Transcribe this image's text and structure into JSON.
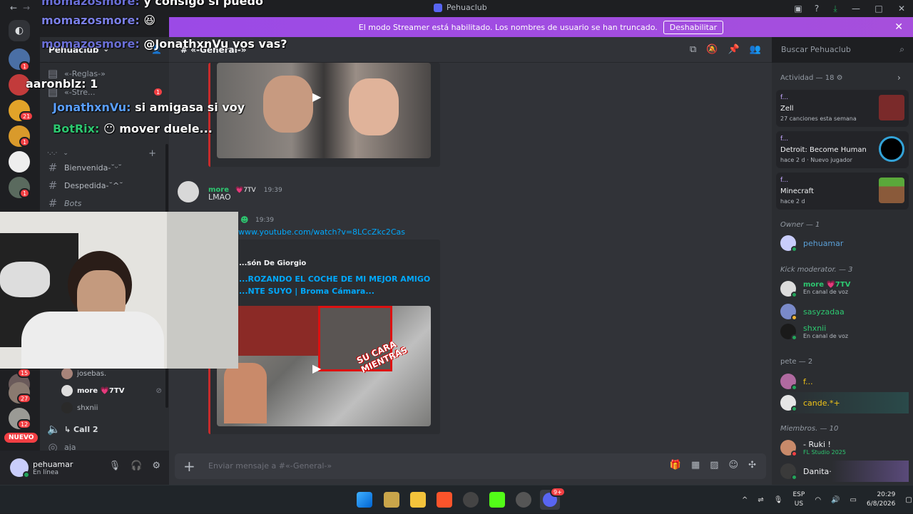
{
  "window": {
    "title": "Pehuaclub",
    "controls": [
      "inbox-icon",
      "help-icon",
      "download-icon",
      "minimize-icon",
      "maximize-icon",
      "close-icon"
    ]
  },
  "banner": {
    "text": "El modo Streamer está habilitado. Los nombres de usuario se han truncado.",
    "button": "Deshabilitar"
  },
  "server": {
    "name": "Pehuaclub",
    "channels_top": [
      "«-Reglas-»",
      "«-Stre..."
    ],
    "category": "·.·.·",
    "channels": [
      {
        "name": "Bienvenida-˘ᵕ˘",
        "type": "text"
      },
      {
        "name": "Despedida-˘^˘",
        "type": "text"
      },
      {
        "name": "Bots",
        "type": "text"
      }
    ],
    "voice_users": [
      "josebas.",
      "more 💗7TV",
      "shxnii"
    ],
    "voice_channels": [
      "↳ Call 2",
      "aja"
    ],
    "new_label": "NUEVO"
  },
  "rail_badges": [
    "1",
    "21",
    "1",
    "1",
    "15",
    "27",
    "12"
  ],
  "user_panel": {
    "username": "pehuamar",
    "status": "En línea"
  },
  "chat": {
    "channel": "«-General-»",
    "messages": [
      {
        "author": "more",
        "tag": "💗7TV",
        "time": "19:39",
        "text": "LMAO"
      },
      {
        "author": "",
        "tag": "",
        "time": "19:39",
        "text": "www.youtube.com/watch?v=8LCcZkc2Cas"
      }
    ],
    "embed": {
      "channel_author": "...són De Giorgio",
      "title_line1": "...ROZANDO EL COCHE DE MI MEJOR AMIGO",
      "title_line2": "...NTE SUYO | Broma Cámara...",
      "thumb_caption": "SU CARA MIENTRAS"
    },
    "composer_placeholder": "Enviar mensaje a #«-General-»"
  },
  "search": {
    "placeholder": "Buscar Pehuaclub"
  },
  "members": {
    "activity_header": "Actividad — 18",
    "activities": [
      {
        "who": "f...",
        "game": "Zell",
        "sub": "27 canciones esta semana"
      },
      {
        "who": "f...",
        "game": "Detroit: Become Human",
        "sub": "hace 2 d",
        "extra": "Nuevo jugador"
      },
      {
        "who": "f...",
        "game": "Minecraft",
        "sub": "hace 2 d"
      }
    ],
    "sections": [
      {
        "title": "Owner — 1",
        "members": [
          {
            "name": "pehuamar",
            "color": "#5a9fd6",
            "status": ""
          }
        ]
      },
      {
        "title": "Kick moderator. — 3",
        "members": [
          {
            "name": "more 💗7TV",
            "color": "#2dc770",
            "status": "En canal de voz"
          },
          {
            "name": "sasyzadaa",
            "color": "#2dc770",
            "status": ""
          },
          {
            "name": "shxnii",
            "color": "#2dc770",
            "status": "En canal de voz"
          }
        ]
      },
      {
        "title": "pete — 2",
        "members": [
          {
            "name": "f...",
            "color": "#f0c419",
            "status": ""
          },
          {
            "name": "cande.*+",
            "color": "#f0c419",
            "status": ""
          }
        ]
      },
      {
        "title": "Miembros. — 10",
        "members": [
          {
            "name": "- Ruki !",
            "color": "#f2f3f5",
            "status": "FL Studio 2025"
          },
          {
            "name": "Danita·",
            "color": "#f2f3f5",
            "status": ""
          }
        ]
      }
    ]
  },
  "overlay_chat": [
    {
      "user": "momazosmore:",
      "text": "y consigo si puedo"
    },
    {
      "user": "momazosmore:",
      "text": ""
    },
    {
      "user": "momazosmore:",
      "text": "@JonathxnVu vos vas?"
    },
    {
      "user": "aaronblz:",
      "text": "1"
    },
    {
      "user": "JonathxnVu:",
      "text": "si amigasa si voy"
    },
    {
      "user": "BotRix:",
      "text": "mover duele..."
    }
  ],
  "taskbar": {
    "lang": "ESP",
    "region": "US",
    "time": "20:29",
    "date": "6/8/2026",
    "discord_badge": "9+"
  }
}
